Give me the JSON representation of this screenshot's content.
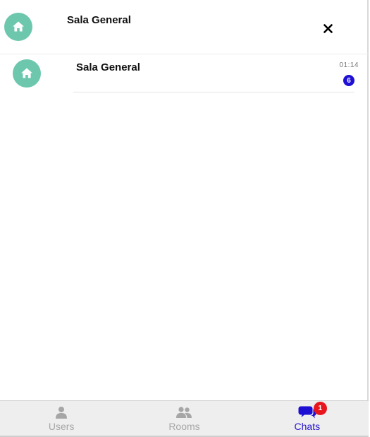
{
  "header": {
    "title": "Sala General",
    "avatar_icon": "home-icon",
    "close_icon": "close-icon"
  },
  "chats": [
    {
      "name": "Sala General",
      "time": "01:14",
      "unread": "6",
      "icon": "home-icon"
    }
  ],
  "nav": {
    "tabs": [
      {
        "label": "Users",
        "icon": "user-icon",
        "active": false
      },
      {
        "label": "Rooms",
        "icon": "users-group-icon",
        "active": false
      },
      {
        "label": "Chats",
        "icon": "chat-bubbles-icon",
        "active": true,
        "badge": "1"
      }
    ]
  },
  "colors": {
    "avatar": "#6cc7ad",
    "accent": "#2412cc",
    "unread_badge": "#1e0fd4",
    "notify_badge": "#e8161c",
    "nav_inactive": "#a6a6a6"
  }
}
